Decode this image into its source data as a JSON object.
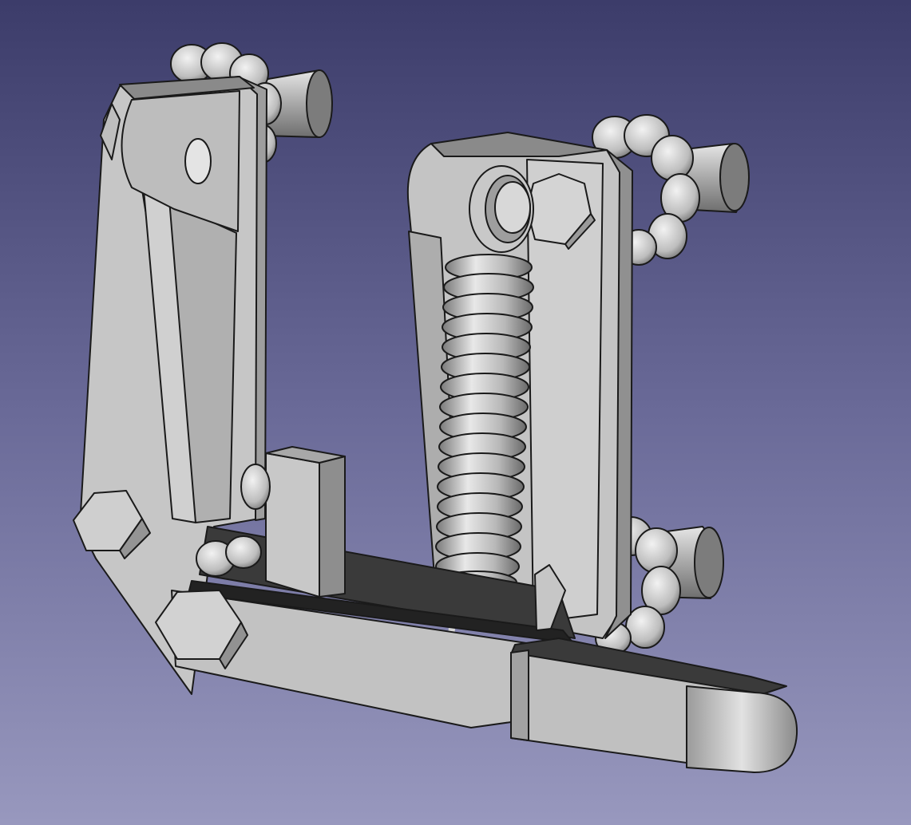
{
  "viewport": {
    "background_top": "#3c3c6a",
    "background_bottom": "#9898be"
  },
  "model": {
    "material_light": "#d2d2d2",
    "material_mid": "#b4b4b4",
    "material_dark": "#8a8a8a",
    "edge_color": "#1a1a1a",
    "parts": [
      "left-bracket",
      "right-bracket",
      "tension-spring",
      "lever-arm",
      "hex-bolt",
      "knurled-roller",
      "shaft"
    ]
  }
}
